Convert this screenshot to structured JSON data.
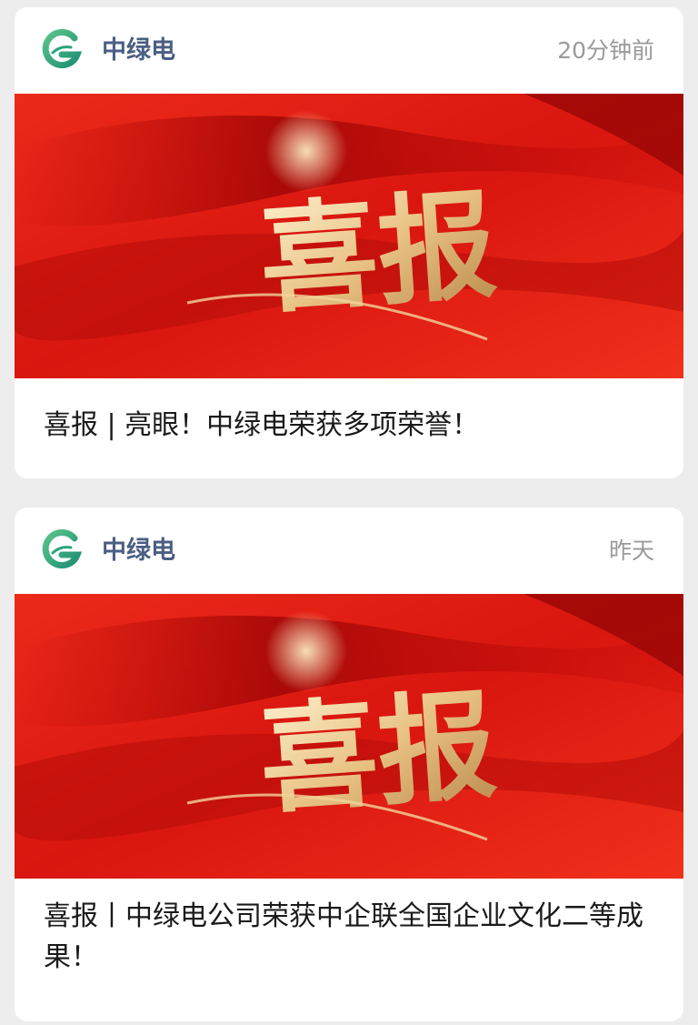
{
  "feed": {
    "articles": [
      {
        "source": "中绿电",
        "time": "20分钟前",
        "banner_text": "喜报",
        "headline": "喜报 | 亮眼！中绿电荣获多项荣誉！"
      },
      {
        "source": "中绿电",
        "time": "昨天",
        "banner_text": "喜报",
        "headline": "喜报丨中绿电公司荣获中企联全国企业文化二等成果！"
      }
    ]
  },
  "colors": {
    "background": "#ededed",
    "card": "#ffffff",
    "source_text": "#4b5e83",
    "time_text": "#9a9a9a",
    "logo_green": "#2aa57a",
    "banner_red": "#e11a12",
    "banner_gold": "#f2d59a"
  },
  "icons": {
    "logo": "zhonglvdian-logo-icon"
  }
}
